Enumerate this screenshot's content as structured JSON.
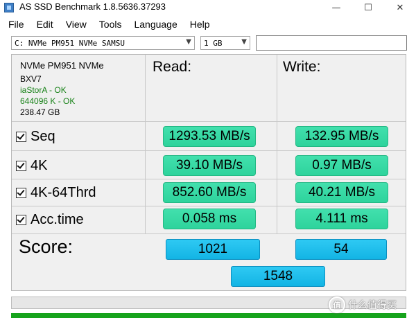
{
  "window": {
    "title": "AS SSD Benchmark 1.8.5636.37293",
    "minimize_glyph": "—",
    "maximize_glyph": "☐",
    "close_glyph": "✕"
  },
  "menu": [
    "File",
    "Edit",
    "View",
    "Tools",
    "Language",
    "Help"
  ],
  "toolbar": {
    "drive_select": "C: NVMe PM951 NVMe SAMSU",
    "size_select": "1 GB",
    "search_value": ""
  },
  "drive_info": {
    "model": "NVMe PM951 NVMe",
    "firmware": "BXV7",
    "driver": "iaStorA - OK",
    "alignment": "644096 K - OK",
    "capacity": "238.47 GB"
  },
  "columns": {
    "read": "Read:",
    "write": "Write:"
  },
  "rows": [
    {
      "label": "Seq",
      "checked": true,
      "read": "1293.53 MB/s",
      "write": "132.95 MB/s"
    },
    {
      "label": "4K",
      "checked": true,
      "read": "39.10 MB/s",
      "write": "0.97 MB/s"
    },
    {
      "label": "4K-64Thrd",
      "checked": true,
      "read": "852.60 MB/s",
      "write": "40.21 MB/s"
    },
    {
      "label": "Acc.time",
      "checked": true,
      "read": "0.058 ms",
      "write": "4.111 ms"
    }
  ],
  "score": {
    "label": "Score:",
    "read": "1021",
    "write": "54",
    "total": "1548"
  },
  "progress": {
    "value": 0
  },
  "watermark": {
    "badge": "值",
    "text": "什么值得买"
  },
  "colors": {
    "result_green": "#34d8a2",
    "score_blue": "#1dbdec",
    "ok_text": "#178217",
    "status_bar": "#16a31c"
  }
}
